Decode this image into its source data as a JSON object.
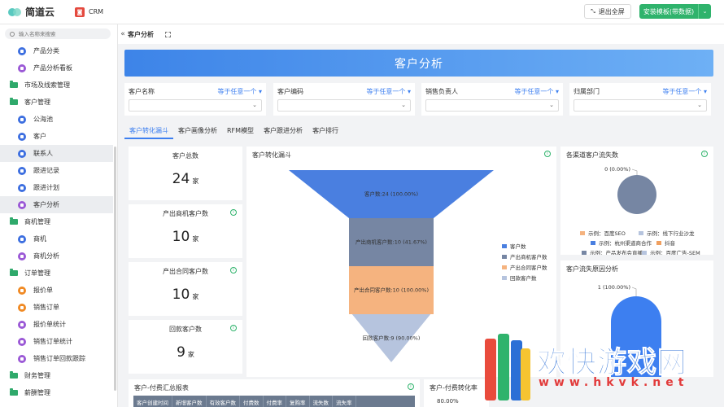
{
  "topbar": {
    "brand": "简道云",
    "app_name": "CRM",
    "exit_fullscreen": "退出全屏",
    "install_template": "安装模板(带数据)"
  },
  "sidebar": {
    "search_placeholder": "输入名称来搜索",
    "items": [
      {
        "label": "产品分类",
        "type": "child",
        "icon_color": "#3d6fe0"
      },
      {
        "label": "产品分析看板",
        "type": "child",
        "icon_color": "#9b59d6"
      },
      {
        "label": "市场及线索管理",
        "type": "group"
      },
      {
        "label": "客户管理",
        "type": "group"
      },
      {
        "label": "公海池",
        "type": "child",
        "icon_color": "#3d6fe0"
      },
      {
        "label": "客户",
        "type": "child",
        "icon_color": "#3d6fe0"
      },
      {
        "label": "联系人",
        "type": "child",
        "icon_color": "#3d6fe0",
        "active": true
      },
      {
        "label": "跟进记录",
        "type": "child",
        "icon_color": "#3d6fe0"
      },
      {
        "label": "跟进计划",
        "type": "child",
        "icon_color": "#3d6fe0"
      },
      {
        "label": "客户分析",
        "type": "child",
        "icon_color": "#9b59d6",
        "active": true
      },
      {
        "label": "商机管理",
        "type": "group"
      },
      {
        "label": "商机",
        "type": "child",
        "icon_color": "#3d6fe0"
      },
      {
        "label": "商机分析",
        "type": "child",
        "icon_color": "#9b59d6"
      },
      {
        "label": "订单管理",
        "type": "group"
      },
      {
        "label": "报价单",
        "type": "child",
        "icon_color": "#f08a24"
      },
      {
        "label": "销售订单",
        "type": "child",
        "icon_color": "#f08a24"
      },
      {
        "label": "报价单统计",
        "type": "child",
        "icon_color": "#9b59d6"
      },
      {
        "label": "销售订单统计",
        "type": "child",
        "icon_color": "#9b59d6"
      },
      {
        "label": "销售订单回款跟踪",
        "type": "child",
        "icon_color": "#9b59d6"
      },
      {
        "label": "财务管理",
        "type": "group"
      },
      {
        "label": "薪酬管理",
        "type": "group"
      }
    ]
  },
  "page": {
    "breadcrumb_title": "客户分析",
    "banner_title": "客户分析"
  },
  "filters": [
    {
      "label": "客户名称",
      "operator": "等于任意一个"
    },
    {
      "label": "客户编码",
      "operator": "等于任意一个"
    },
    {
      "label": "销售负责人",
      "operator": "等于任意一个"
    },
    {
      "label": "归属部门",
      "operator": "等于任意一个"
    }
  ],
  "tabs": [
    "客户转化漏斗",
    "客户画像分析",
    "RFM模型",
    "客户跟进分析",
    "客户排行"
  ],
  "kpis": [
    {
      "title": "客户总数",
      "value": "24",
      "unit": "家"
    },
    {
      "title": "产出商机客户数",
      "value": "10",
      "unit": "家"
    },
    {
      "title": "产出合同客户数",
      "value": "10",
      "unit": "家"
    },
    {
      "title": "回款客户数",
      "value": "9",
      "unit": "家"
    }
  ],
  "funnel_panel": {
    "title": "客户转化漏斗",
    "chart_data": {
      "type": "funnel",
      "stages": [
        {
          "name": "客户数",
          "value": 24,
          "label": "客户数:24 (100.00%)",
          "color": "#4a7fe0"
        },
        {
          "name": "产出商机客户数",
          "value": 10,
          "label": "产出商机客户数:10 (41.67%)",
          "color": "#7686a3"
        },
        {
          "name": "产出合同客户数",
          "value": 10,
          "label": "产出合同客户数:10 (100.00%)",
          "color": "#f5b37f"
        },
        {
          "name": "回款客户数",
          "value": 9,
          "label": "回款客户数:9 (90.00%)",
          "color": "#b6c4de"
        }
      ]
    }
  },
  "loss_panel": {
    "title": "各渠道客户流失数",
    "chart_data": {
      "type": "pie",
      "label": "0 (0.00%)",
      "color": "#7686a3",
      "legend": [
        {
          "name": "示例：百度SEO",
          "color": "#f5b37f"
        },
        {
          "name": "示例：线下行业沙龙",
          "color": "#b6c4de"
        },
        {
          "name": "示例：杭州渠道商合作",
          "color": "#4a7fe0"
        },
        {
          "name": "抖音",
          "color": "#f0a060"
        },
        {
          "name": "示例：产品发布会直播",
          "color": "#7686a3"
        },
        {
          "name": "示例：百度广告-SEM",
          "color": "#b6c4de"
        }
      ]
    }
  },
  "reason_panel": {
    "title": "客户流失原因分析",
    "chart_data": {
      "type": "pie",
      "label": "1 (100.00%)",
      "color": "#3d7ff0"
    }
  },
  "summary_panel": {
    "title": "客户-付费汇总报表",
    "columns": [
      "客户创建时间",
      "新增客户数",
      "有效客户数",
      "付费数",
      "付费率",
      "复购率",
      "流失数",
      "流失率"
    ]
  },
  "conversion_panel": {
    "title": "客户-付费转化率",
    "value_label": "80.00%"
  },
  "watermark": {
    "text": "欢快游戏网",
    "url": "www.hkvk.net"
  }
}
